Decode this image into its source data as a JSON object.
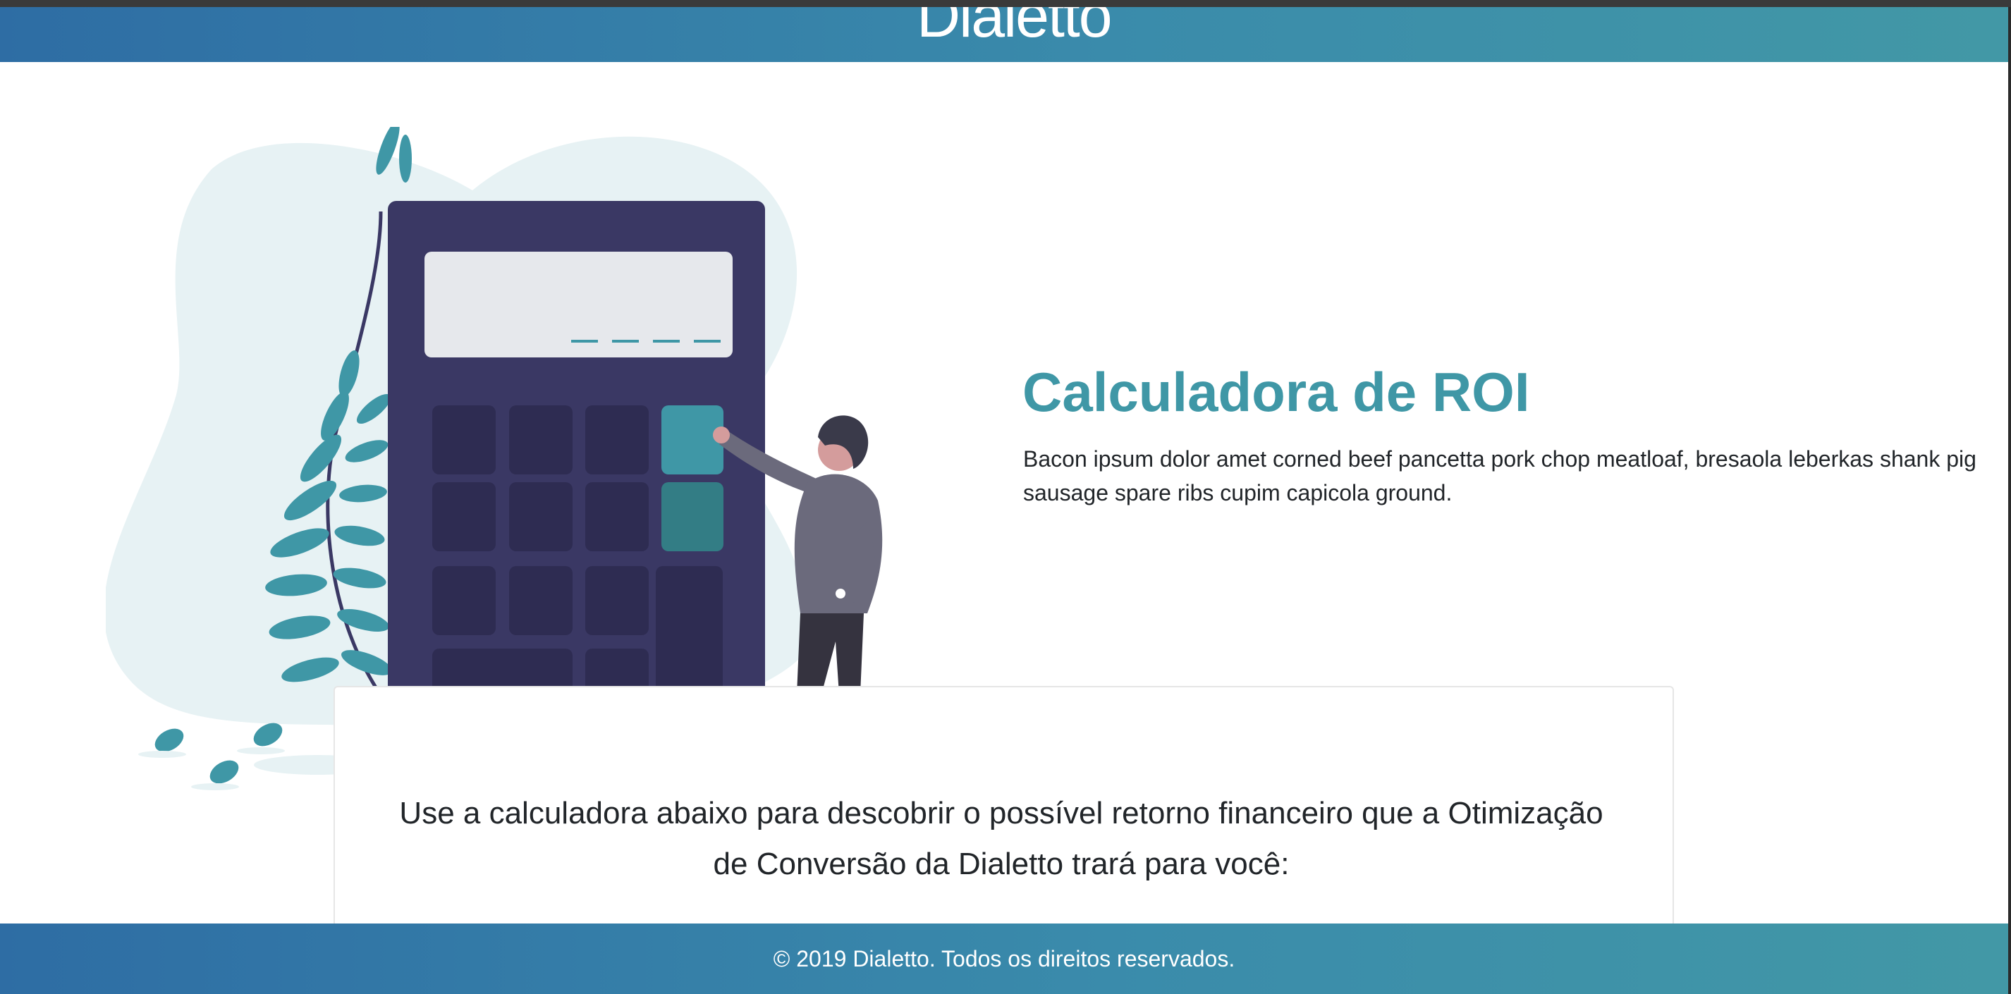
{
  "header": {
    "logo_text": "Dialetto"
  },
  "hero": {
    "title": "Calculadora de ROI",
    "description": "Bacon ipsum dolor amet corned beef pancetta pork chop meatloaf, bresaola leberkas shank pig sausage spare ribs cupim capicola ground."
  },
  "calculator": {
    "intro_text": "Use a calculadora abaixo para descobrir o possível retorno financeiro que a Otimização de Conversão da Dialetto trará para você:"
  },
  "footer": {
    "copyright": "© 2019 Dialetto. Todos os direitos reservados."
  },
  "colors": {
    "brand_teal": "#3f97a6",
    "header_gradient_start": "#2e6da4",
    "header_gradient_end": "#4298a6",
    "calculator_body": "#3a3864",
    "blob": "#e7f2f4"
  }
}
